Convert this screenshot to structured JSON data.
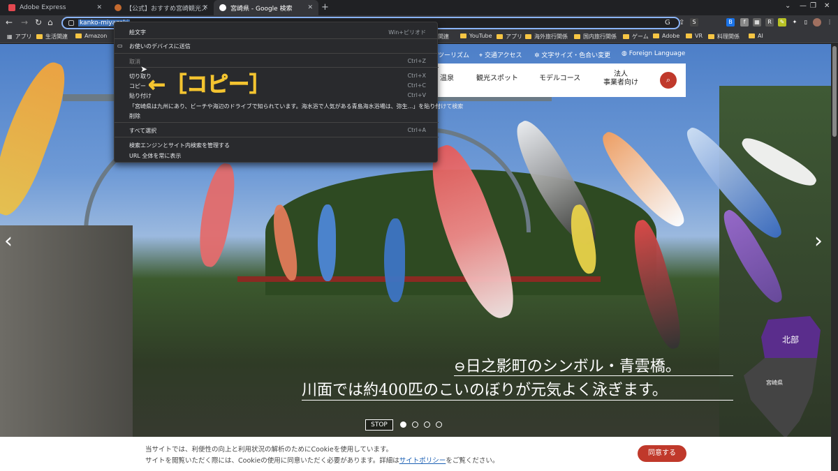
{
  "tabs": [
    {
      "label": "Adobe Express",
      "active": false
    },
    {
      "label": "【公式】おすすめ宮崎観光スポット／...",
      "active": false
    },
    {
      "label": "宮崎県 - Google 検索",
      "active": true
    }
  ],
  "omnibox": {
    "url": "kanko-miyazaki"
  },
  "bookmarks": [
    "アプリ",
    "生活関連",
    "Amazon",
    "関連",
    "YouTube",
    "アプリ",
    "海外旅行関係",
    "国内旅行関係",
    "ゲーム",
    "Adobe",
    "VR",
    "料理関係",
    "AI"
  ],
  "context_menu": {
    "items": [
      {
        "label": "絵文字",
        "shortcut": "Win+ピリオド",
        "disabled": false
      },
      {
        "label": "お使いのデバイスに送信",
        "shortcut": "",
        "disabled": false
      },
      {
        "label": "取消",
        "shortcut": "Ctrl+Z",
        "disabled": true
      },
      {
        "label": "切り取り",
        "shortcut": "Ctrl+X",
        "disabled": false
      },
      {
        "label": "コピー",
        "shortcut": "Ctrl+C",
        "disabled": false
      },
      {
        "label": "貼り付け",
        "shortcut": "Ctrl+V",
        "disabled": false
      },
      {
        "label": "「宮崎県は九州にあり、ビーチや海辺のドライブで知られています。海水浴で人気がある青島海水浴場は、弥生...」を貼り付けて検索",
        "shortcut": "",
        "disabled": false
      },
      {
        "label": "削除",
        "shortcut": "",
        "disabled": false
      },
      {
        "label": "すべて選択",
        "shortcut": "Ctrl+A",
        "disabled": false
      },
      {
        "label": "検索エンジンとサイト内検索を管理する",
        "shortcut": "",
        "disabled": false
      },
      {
        "label": "URL 全体を常に表示",
        "shortcut": "",
        "disabled": false
      }
    ]
  },
  "annotation": "←［コピー］",
  "site": {
    "top_links": [
      "ツーリズム",
      "交通アクセス",
      "文字サイズ・色合い変更",
      "Foreign Language"
    ],
    "nav": [
      "温泉",
      "観光スポット",
      "モデルコース",
      "法人\n事業者向け"
    ],
    "caption_line1": "日之影町のシンボル・青雲橋。",
    "caption_line2": "川面では約400匹のこいのぼりが元気よく泳ぎます。",
    "stop_label": "STOP",
    "map_label_north": "北部",
    "map_label_pref": "宮崎県",
    "cookie_line1": "当サイトでは、利便性の向上と利用状況の解析のためにCookieを使用しています。",
    "cookie_line2_pre": "サイトを閲覧いただく際には、Cookieの使用に同意いただく必要があります。詳細は",
    "cookie_link": "サイトポリシー",
    "cookie_line2_post": "をご覧ください。",
    "agree_label": "同意する"
  },
  "colors": {
    "accent": "#c0392b",
    "highlight": "#f4c430",
    "map_north": "#5a2d8c"
  }
}
